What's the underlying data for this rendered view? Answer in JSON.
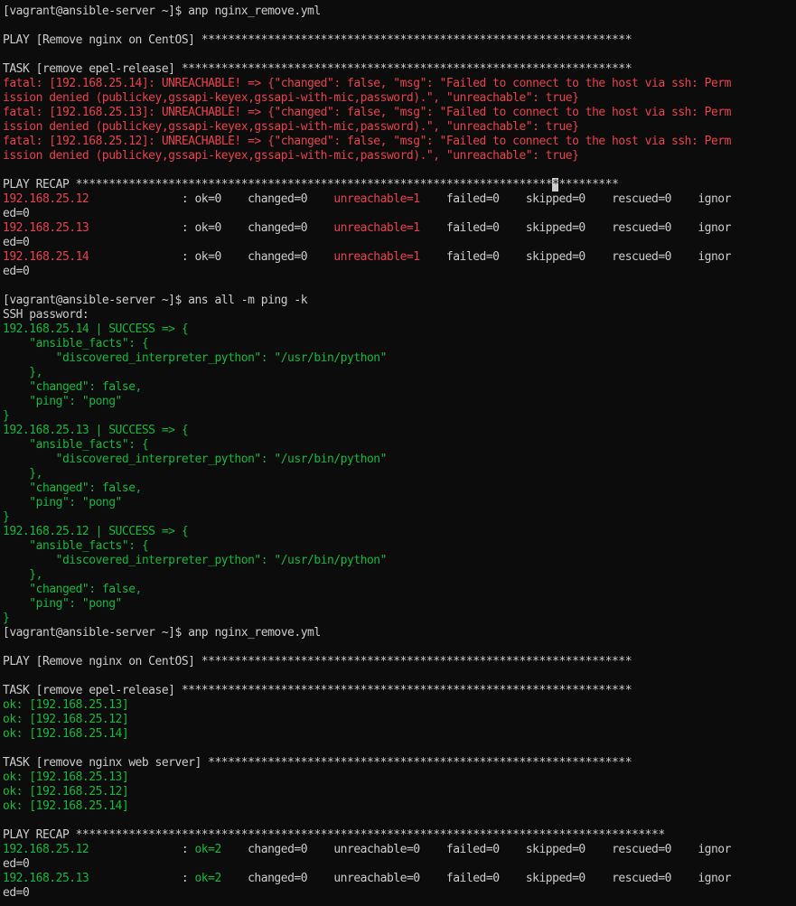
{
  "colors": {
    "background": "#0c0c0c",
    "default": "#cccccc",
    "red": "#e8414b",
    "green": "#14b83c"
  },
  "lines": [
    [
      {
        "c": "w",
        "t": "[vagrant@ansible-server ~]$ anp nginx_remove.yml"
      }
    ],
    [],
    [
      {
        "c": "w",
        "t": "PLAY [Remove nginx on CentOS] *****************************************************************"
      }
    ],
    [],
    [
      {
        "c": "w",
        "t": "TASK [remove epel-release] ********************************************************************"
      }
    ],
    [
      {
        "c": "r",
        "t": "fatal: [192.168.25.14]: UNREACHABLE! => {\"changed\": false, \"msg\": \"Failed to connect to the host via ssh: Perm"
      }
    ],
    [
      {
        "c": "r",
        "t": "ission denied (publickey,gssapi-keyex,gssapi-with-mic,password).\", \"unreachable\": true}"
      }
    ],
    [
      {
        "c": "r",
        "t": "fatal: [192.168.25.13]: UNREACHABLE! => {\"changed\": false, \"msg\": \"Failed to connect to the host via ssh: Perm"
      }
    ],
    [
      {
        "c": "r",
        "t": "ission denied (publickey,gssapi-keyex,gssapi-with-mic,password).\", \"unreachable\": true}"
      }
    ],
    [
      {
        "c": "r",
        "t": "fatal: [192.168.25.12]: UNREACHABLE! => {\"changed\": false, \"msg\": \"Failed to connect to the host via ssh: Perm"
      }
    ],
    [
      {
        "c": "r",
        "t": "ission denied (publickey,gssapi-keyex,gssapi-with-mic,password).\", \"unreachable\": true}"
      }
    ],
    [],
    [
      {
        "c": "w",
        "t": "PLAY RECAP ************************************************************************"
      },
      {
        "c": "cursor",
        "t": "*"
      },
      {
        "c": "w",
        "t": "*********"
      }
    ],
    [
      {
        "c": "r",
        "t": "192.168.25.12"
      },
      {
        "c": "w",
        "t": "              : ok=0    changed=0    "
      },
      {
        "c": "r",
        "t": "unreachable=1"
      },
      {
        "c": "w",
        "t": "    failed=0    skipped=0    rescued=0    ignor"
      }
    ],
    [
      {
        "c": "w",
        "t": "ed=0"
      }
    ],
    [
      {
        "c": "r",
        "t": "192.168.25.13"
      },
      {
        "c": "w",
        "t": "              : ok=0    changed=0    "
      },
      {
        "c": "r",
        "t": "unreachable=1"
      },
      {
        "c": "w",
        "t": "    failed=0    skipped=0    rescued=0    ignor"
      }
    ],
    [
      {
        "c": "w",
        "t": "ed=0"
      }
    ],
    [
      {
        "c": "r",
        "t": "192.168.25.14"
      },
      {
        "c": "w",
        "t": "              : ok=0    changed=0    "
      },
      {
        "c": "r",
        "t": "unreachable=1"
      },
      {
        "c": "w",
        "t": "    failed=0    skipped=0    rescued=0    ignor"
      }
    ],
    [
      {
        "c": "w",
        "t": "ed=0"
      }
    ],
    [],
    [
      {
        "c": "w",
        "t": "[vagrant@ansible-server ~]$ ans all -m ping -k"
      }
    ],
    [
      {
        "c": "w",
        "t": "SSH password:"
      }
    ],
    [
      {
        "c": "g",
        "t": "192.168.25.14 | SUCCESS => {"
      }
    ],
    [
      {
        "c": "g",
        "t": "    \"ansible_facts\": {"
      }
    ],
    [
      {
        "c": "g",
        "t": "        \"discovered_interpreter_python\": \"/usr/bin/python\""
      }
    ],
    [
      {
        "c": "g",
        "t": "    },"
      }
    ],
    [
      {
        "c": "g",
        "t": "    \"changed\": false,"
      }
    ],
    [
      {
        "c": "g",
        "t": "    \"ping\": \"pong\""
      }
    ],
    [
      {
        "c": "g",
        "t": "}"
      }
    ],
    [
      {
        "c": "g",
        "t": "192.168.25.13 | SUCCESS => {"
      }
    ],
    [
      {
        "c": "g",
        "t": "    \"ansible_facts\": {"
      }
    ],
    [
      {
        "c": "g",
        "t": "        \"discovered_interpreter_python\": \"/usr/bin/python\""
      }
    ],
    [
      {
        "c": "g",
        "t": "    },"
      }
    ],
    [
      {
        "c": "g",
        "t": "    \"changed\": false,"
      }
    ],
    [
      {
        "c": "g",
        "t": "    \"ping\": \"pong\""
      }
    ],
    [
      {
        "c": "g",
        "t": "}"
      }
    ],
    [
      {
        "c": "g",
        "t": "192.168.25.12 | SUCCESS => {"
      }
    ],
    [
      {
        "c": "g",
        "t": "    \"ansible_facts\": {"
      }
    ],
    [
      {
        "c": "g",
        "t": "        \"discovered_interpreter_python\": \"/usr/bin/python\""
      }
    ],
    [
      {
        "c": "g",
        "t": "    },"
      }
    ],
    [
      {
        "c": "g",
        "t": "    \"changed\": false,"
      }
    ],
    [
      {
        "c": "g",
        "t": "    \"ping\": \"pong\""
      }
    ],
    [
      {
        "c": "g",
        "t": "}"
      }
    ],
    [
      {
        "c": "w",
        "t": "[vagrant@ansible-server ~]$ anp nginx_remove.yml"
      }
    ],
    [],
    [
      {
        "c": "w",
        "t": "PLAY [Remove nginx on CentOS] *****************************************************************"
      }
    ],
    [],
    [
      {
        "c": "w",
        "t": "TASK [remove epel-release] ********************************************************************"
      }
    ],
    [
      {
        "c": "g",
        "t": "ok: [192.168.25.13]"
      }
    ],
    [
      {
        "c": "g",
        "t": "ok: [192.168.25.12]"
      }
    ],
    [
      {
        "c": "g",
        "t": "ok: [192.168.25.14]"
      }
    ],
    [],
    [
      {
        "c": "w",
        "t": "TASK [remove nginx web server] ****************************************************************"
      }
    ],
    [
      {
        "c": "g",
        "t": "ok: [192.168.25.13]"
      }
    ],
    [
      {
        "c": "g",
        "t": "ok: [192.168.25.12]"
      }
    ],
    [
      {
        "c": "g",
        "t": "ok: [192.168.25.14]"
      }
    ],
    [],
    [
      {
        "c": "w",
        "t": "PLAY RECAP *****************************************************************************************"
      }
    ],
    [
      {
        "c": "g",
        "t": "192.168.25.12"
      },
      {
        "c": "w",
        "t": "              : "
      },
      {
        "c": "g",
        "t": "ok=2"
      },
      {
        "c": "w",
        "t": "    changed=0    unreachable=0    failed=0    skipped=0    rescued=0    ignor"
      }
    ],
    [
      {
        "c": "w",
        "t": "ed=0"
      }
    ],
    [
      {
        "c": "g",
        "t": "192.168.25.13"
      },
      {
        "c": "w",
        "t": "              : "
      },
      {
        "c": "g",
        "t": "ok=2"
      },
      {
        "c": "w",
        "t": "    changed=0    unreachable=0    failed=0    skipped=0    rescued=0    ignor"
      }
    ],
    [
      {
        "c": "w",
        "t": "ed=0"
      }
    ]
  ]
}
